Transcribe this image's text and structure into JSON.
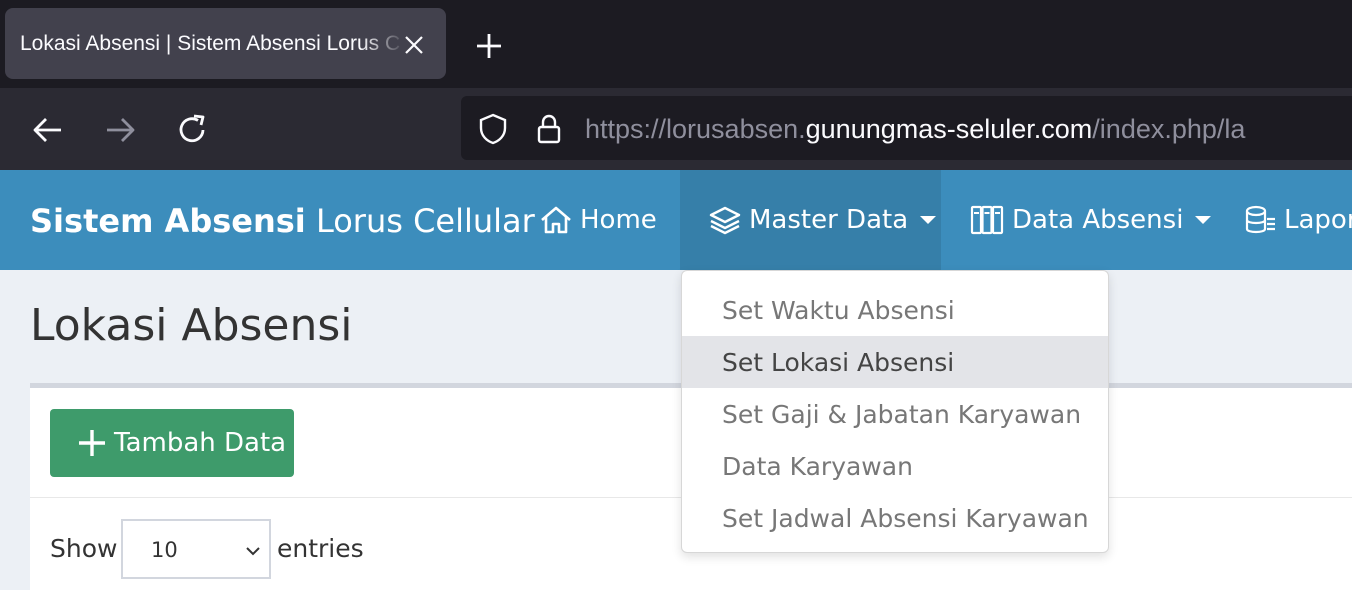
{
  "browser": {
    "tab_title": "Lokasi Absensi | Sistem Absensi Lorus Cellular",
    "url_prefix": "https://lorusabsen.",
    "url_host": "gunungmas-seluler.com",
    "url_suffix": "/index.php/la"
  },
  "header": {
    "brand_bold": "Sistem Absensi",
    "brand_light": "Lorus Cellular",
    "nav": {
      "home": "Home",
      "master_data": "Master Data",
      "data_absensi": "Data Absensi",
      "laporan": "Lapor"
    }
  },
  "dropdown": {
    "items": [
      "Set Waktu Absensi",
      "Set Lokasi Absensi",
      "Set Gaji & Jabatan Karyawan",
      "Data Karyawan",
      "Set Jadwal Absensi Karyawan"
    ],
    "active_index": 1
  },
  "page": {
    "title": "Lokasi Absensi",
    "add_button": "Tambah Data",
    "show_label": "Show",
    "entries_label": "entries",
    "page_length": "10"
  },
  "colors": {
    "header_bg": "#3c8dbc",
    "header_active_bg": "#367fa9",
    "add_button_bg": "#3e9b6b",
    "page_bg": "#ecf0f5"
  }
}
